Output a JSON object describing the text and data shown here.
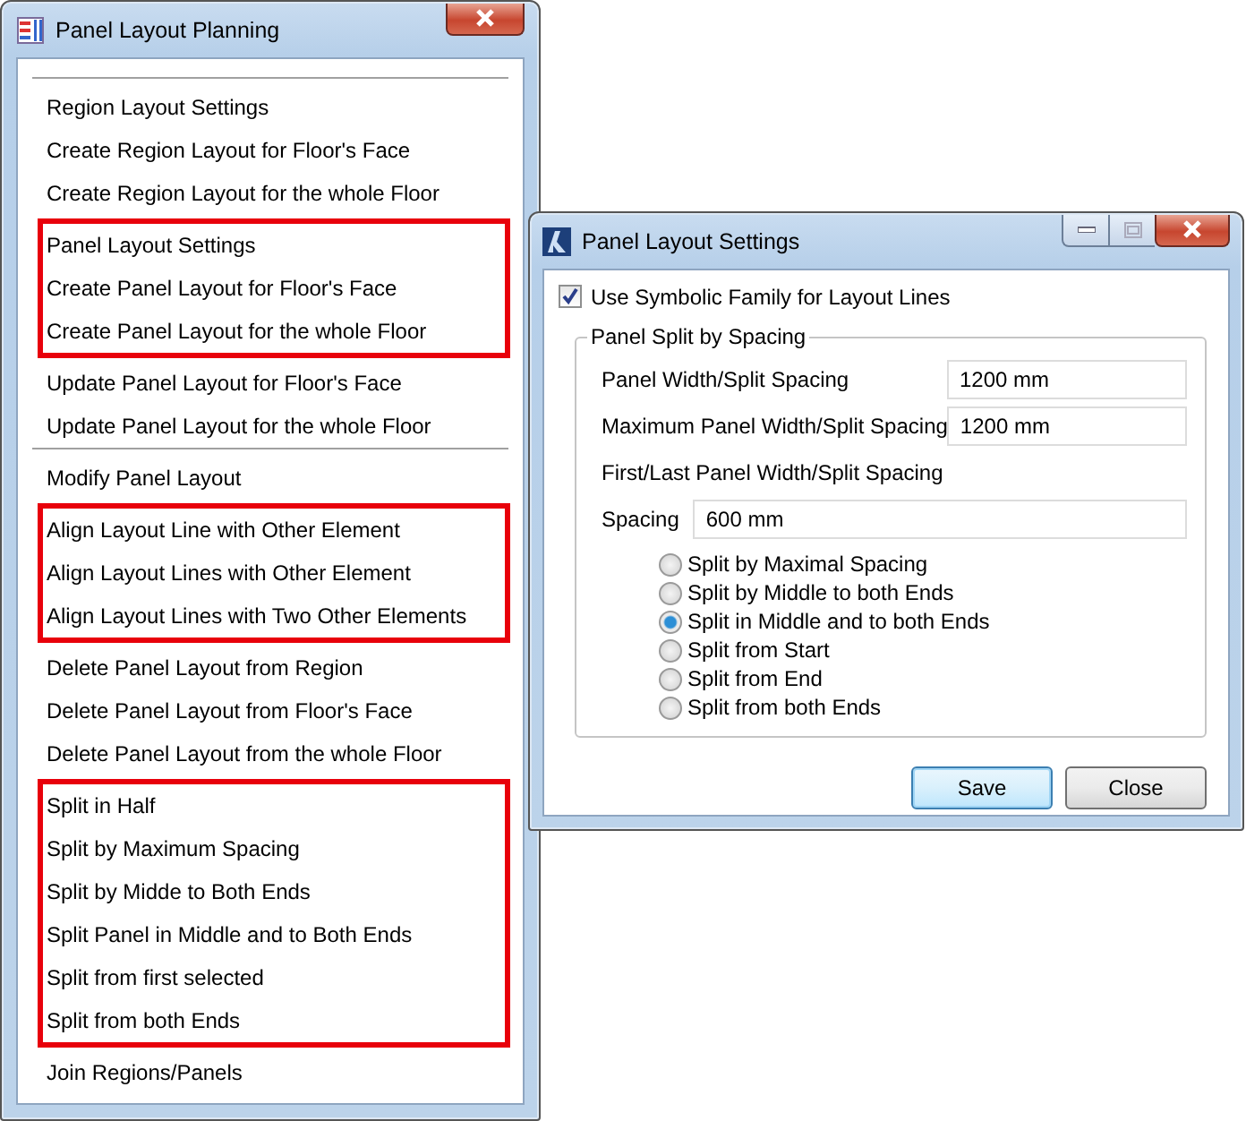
{
  "planning_window": {
    "title": "Panel Layout Planning",
    "groups": [
      {
        "separator_before": true,
        "highlighted": false,
        "items": [
          "Region Layout Settings",
          "Create Region Layout for Floor's Face",
          "Create Region Layout for the whole Floor"
        ]
      },
      {
        "separator_before": false,
        "highlighted": true,
        "items": [
          "Panel Layout Settings",
          "Create Panel Layout for Floor's Face",
          "Create Panel Layout for the whole Floor"
        ]
      },
      {
        "separator_before": false,
        "highlighted": false,
        "items": [
          "Update Panel Layout for Floor's Face",
          "Update Panel Layout for the whole Floor"
        ]
      },
      {
        "separator_before": true,
        "highlighted": false,
        "items": [
          "Modify Panel Layout"
        ]
      },
      {
        "separator_before": false,
        "highlighted": true,
        "items": [
          "Align Layout Line with Other Element",
          "Align Layout Lines with Other Element",
          "Align Layout Lines with Two Other Elements"
        ]
      },
      {
        "separator_before": false,
        "highlighted": false,
        "items": [
          "Delete Panel Layout from Region",
          "Delete Panel Layout from Floor's Face",
          "Delete Panel Layout from the whole Floor"
        ]
      },
      {
        "separator_before": false,
        "highlighted": true,
        "items": [
          "Split in Half",
          "Split by Maximum Spacing",
          "Split by Midde to Both Ends",
          "Split Panel in Middle and to Both Ends",
          "Split from first selected",
          "Split from both Ends"
        ]
      },
      {
        "separator_before": false,
        "highlighted": false,
        "items": [
          "Join Regions/Panels"
        ]
      }
    ]
  },
  "settings_dialog": {
    "title": "Panel Layout Settings",
    "checkbox": {
      "label": "Use Symbolic Family for Layout Lines",
      "checked": true
    },
    "group": {
      "title": "Panel Split by Spacing",
      "fields": [
        {
          "label": "Panel Width/Split Spacing",
          "value": "1200 mm"
        },
        {
          "label": "Maximum Panel Width/Split Spacing",
          "value": "1200 mm"
        }
      ],
      "first_last_label": "First/Last Panel Width/Split Spacing",
      "spacing": {
        "label": "Spacing",
        "value": "600 mm"
      },
      "options": [
        {
          "label": "Split by Maximal Spacing",
          "selected": false
        },
        {
          "label": "Split by Middle to both Ends",
          "selected": false
        },
        {
          "label": "Split in Middle and to both Ends",
          "selected": true
        },
        {
          "label": "Split from Start",
          "selected": false
        },
        {
          "label": "Split from End",
          "selected": false
        },
        {
          "label": "Split from both Ends",
          "selected": false
        }
      ]
    },
    "buttons": [
      {
        "label": "Save",
        "default": true
      },
      {
        "label": "Close",
        "default": false
      }
    ]
  }
}
